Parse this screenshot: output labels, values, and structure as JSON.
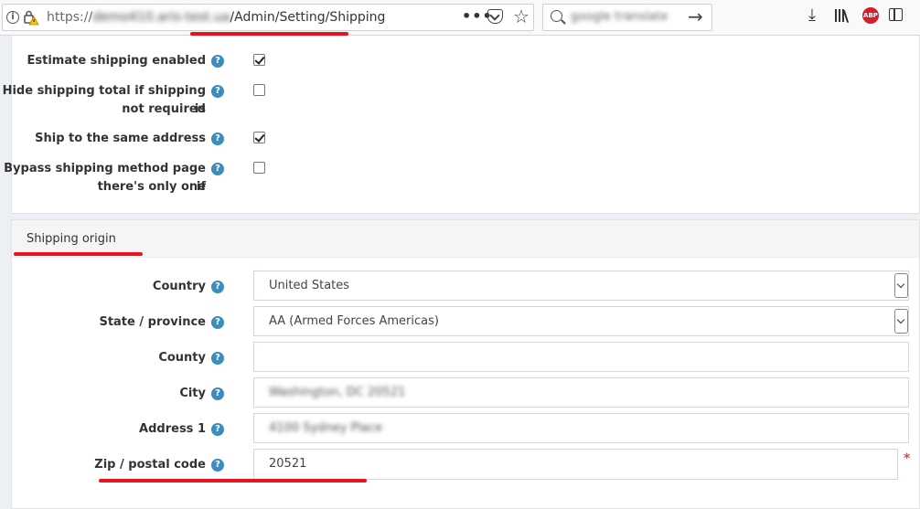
{
  "browser": {
    "url_host": "demo410.aris-test.ua",
    "url_scheme": "https://",
    "url_path": "/Admin/Setting/Shipping",
    "search_query": "google translate",
    "abp_label": "ABP"
  },
  "shipping_options": {
    "estimate_enabled": {
      "label": "Estimate shipping enabled",
      "checked": true
    },
    "hide_total": {
      "label_line1": "Hide shipping total if shipping is",
      "label_line2": "not required",
      "checked": false
    },
    "ship_same_address": {
      "label": "Ship to the same address",
      "checked": true
    },
    "bypass_method": {
      "label_line1": "Bypass shipping method page if",
      "label_line2": "there's only one",
      "checked": false
    }
  },
  "shipping_origin": {
    "heading": "Shipping origin",
    "country": {
      "label": "Country",
      "value": "United States"
    },
    "state": {
      "label": "State / province",
      "value": "AA (Armed Forces Americas)"
    },
    "county": {
      "label": "County",
      "value": ""
    },
    "city": {
      "label": "City",
      "value": "Washington, DC 20521"
    },
    "address1": {
      "label": "Address 1",
      "value": "4100 Sydney Place"
    },
    "zip": {
      "label": "Zip / postal code",
      "value": "20521",
      "required_mark": "*"
    }
  },
  "help_glyph": "?",
  "colors": {
    "help": "#3c8dbc",
    "annotation": "#e8131f",
    "required": "#dd4b39"
  }
}
